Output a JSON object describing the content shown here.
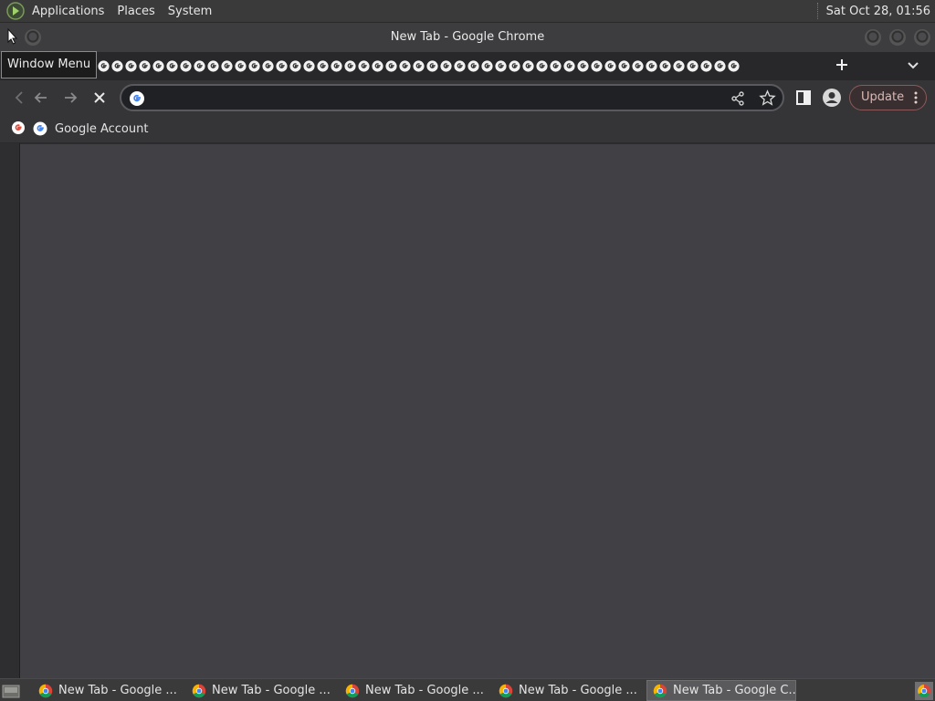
{
  "system_panel": {
    "menus": [
      "Applications",
      "Places",
      "System"
    ],
    "clock": "Sat Oct 28, 01:56"
  },
  "window": {
    "title": "New Tab - Google Chrome",
    "tooltip": "Window Menu"
  },
  "tabstrip": {
    "tab_count_visible": 47,
    "tab_icon": "chrome-favicon-icon"
  },
  "toolbar": {
    "back_icon": "arrow-left-icon",
    "forward_icon": "arrow-right-icon",
    "stop_icon": "close-icon",
    "omnibox_value": "",
    "omnibox_icon": "google-g-icon",
    "share_icon": "share-icon",
    "bookmark_icon": "star-icon",
    "side_panel_icon": "side-panel-icon",
    "profile_icon": "avatar-icon",
    "update_label": "Update",
    "menu_icon": "kebab-menu-icon"
  },
  "bookmarks_bar": {
    "items": [
      {
        "label": "Google Account",
        "icon": "google-g-icon"
      }
    ]
  },
  "taskbar": {
    "tasks": [
      {
        "label": "New Tab - Google ...",
        "active": false
      },
      {
        "label": "New Tab - Google ...",
        "active": false
      },
      {
        "label": "New Tab - Google ...",
        "active": false
      },
      {
        "label": "New Tab - Google ...",
        "active": false
      },
      {
        "label": "New Tab - Google C...",
        "active": true
      }
    ]
  },
  "colors": {
    "panel_bg": "#3a3a3b",
    "content_bg": "#414145",
    "update_accent": "#d9b9b5",
    "omnibox_bg": "#202124"
  }
}
